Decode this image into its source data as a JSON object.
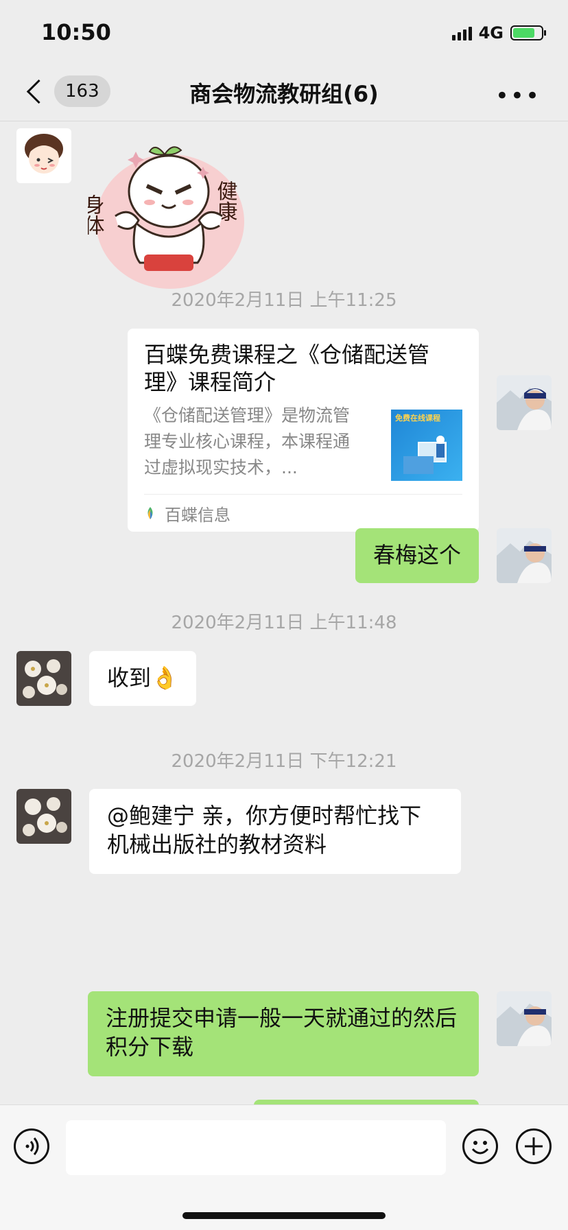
{
  "status_bar": {
    "time": "10:50",
    "network": "4G"
  },
  "nav": {
    "unread_count": "163",
    "title": "商会物流教研组(6)"
  },
  "messages": {
    "sticker": {
      "left_text": "身体",
      "right_text": "健康"
    },
    "ts1": "2020年2月11日 上午11:25",
    "card": {
      "title": "百蝶免费课程之《仓储配送管理》课程简介",
      "desc": "《仓储配送管理》是物流管理专业核心课程，本课程通过虚拟现实技术，...",
      "thumb_text": "免费在线课程",
      "source": "百蝶信息"
    },
    "msg1": "春梅这个",
    "ts2": "2020年2月11日 上午11:48",
    "msg2": "收到👌",
    "ts3": "2020年2月11日 下午12:21",
    "msg3": "@鲍建宁 亲，你方便时帮忙找下机械出版社的教材资料",
    "msg4": "注册提交申请一般一天就通过的然后积分下载"
  },
  "input": {
    "value": ""
  },
  "icons": {
    "back": "chevron-left-icon",
    "more": "more-horizontal-icon",
    "voice": "voice-icon",
    "emoji": "emoji-icon",
    "add": "plus-icon"
  },
  "colors": {
    "bubble_green": "#a4e378",
    "background": "#ededed"
  }
}
